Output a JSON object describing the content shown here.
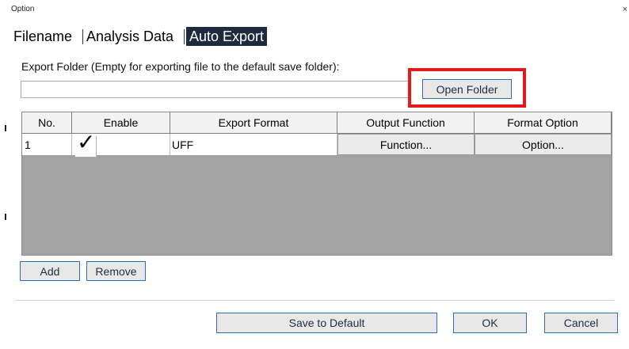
{
  "window": {
    "title": "Option",
    "close_glyph": "×"
  },
  "tabs": [
    {
      "label": "Filename"
    },
    {
      "label": "Analysis Data"
    },
    {
      "label": "Auto Export"
    }
  ],
  "export_folder": {
    "label": "Export Folder (Empty for exporting file to the default save folder):",
    "value": "",
    "open_button": "Open Folder"
  },
  "table": {
    "headers": [
      "No.",
      "Enable",
      "Export Format",
      "Output Function",
      "Format Option"
    ],
    "rows": [
      {
        "no": "1",
        "enabled": true,
        "check_glyph": "✓",
        "format": "UFF",
        "function_button": "Function...",
        "option_button": "Option..."
      }
    ]
  },
  "actions": {
    "add": "Add",
    "remove": "Remove"
  },
  "footer": {
    "save_default": "Save to Default",
    "ok": "OK",
    "cancel": "Cancel"
  },
  "colors": {
    "active_tab": "#1e2a3e",
    "highlight": "#e41a1a",
    "grid_bg": "#a3a3a3",
    "button_border": "#2a6fb6"
  }
}
